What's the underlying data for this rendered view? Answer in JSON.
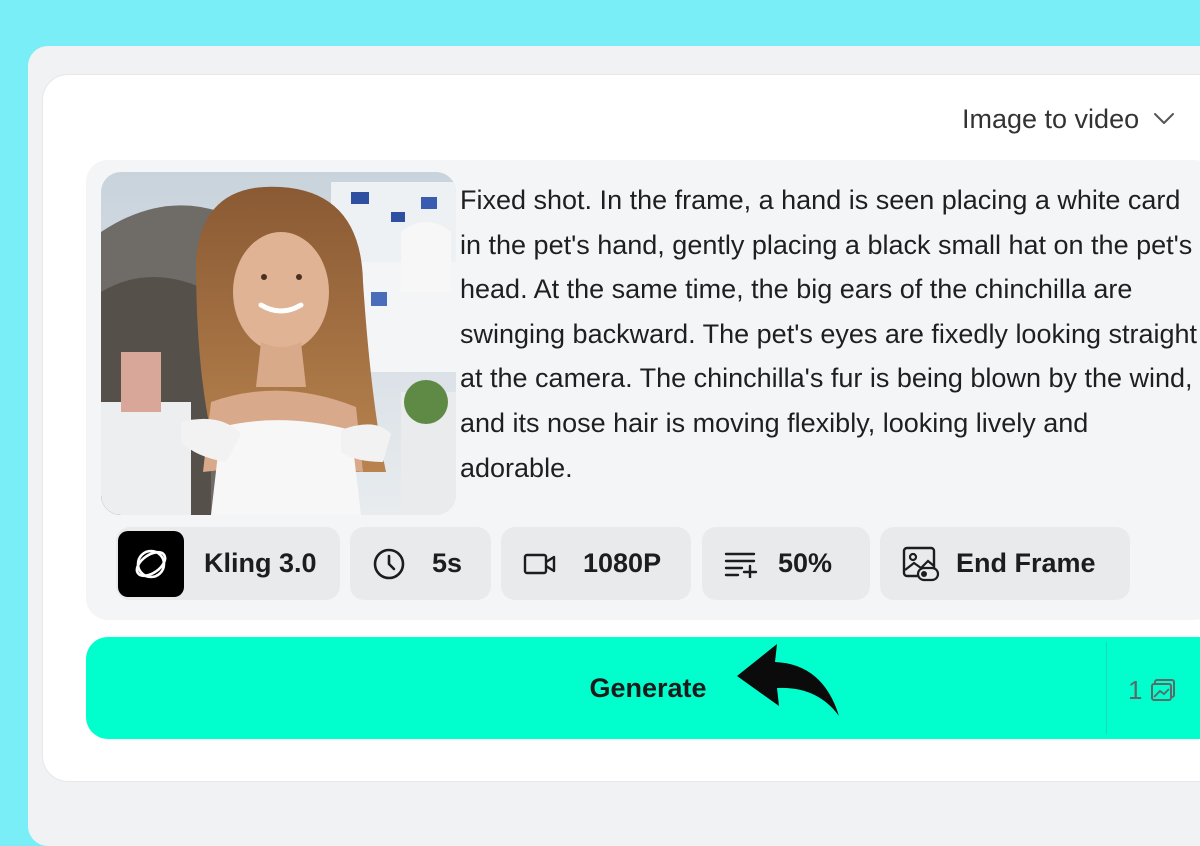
{
  "mode_select": {
    "label": "Image to video"
  },
  "prompt": {
    "text": "Fixed shot. In the frame, a hand is seen placing a white card in the pet's hand, gently placing a black small hat on the pet's head. At the same time, the big ears of the chinchilla are swinging backward. The pet's eyes are fixedly looking straight at the camera. The chinchilla's fur is being blown by the wind, and its nose hair is moving flexibly, looking lively and adorable."
  },
  "settings": {
    "model": "Kling 3.0",
    "duration": "5s",
    "resolution": "1080P",
    "strength": "50%",
    "end_frame": "End Frame"
  },
  "generate": {
    "label": "Generate",
    "credits": "1"
  },
  "colors": {
    "background": "#79eef6",
    "generate_button": "#00ffcc",
    "chip": "#e9eaec",
    "panel": "#f4f5f7"
  },
  "icons": [
    "chevron-down-icon",
    "kling-logo-icon",
    "clock-icon",
    "video-camera-icon",
    "text-lines-icon",
    "image-frame-icon",
    "image-icon",
    "curved-arrow-icon"
  ]
}
